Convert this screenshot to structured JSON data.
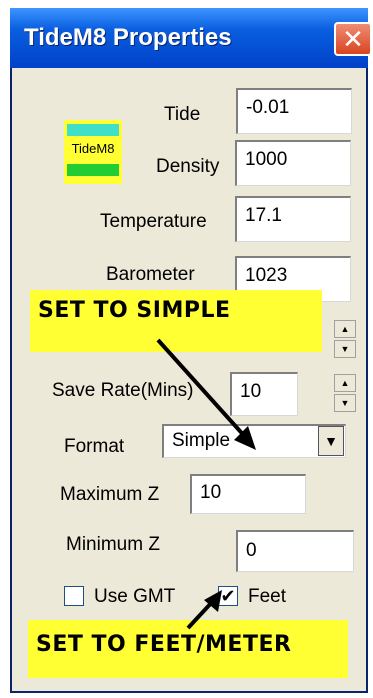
{
  "window": {
    "title": "TideM8 Properties",
    "close_glyph": "✕"
  },
  "logo": {
    "text": "TideM8"
  },
  "fields": {
    "tide": {
      "label": "Tide",
      "value": "-0.01"
    },
    "density": {
      "label": "Density",
      "value": "1000"
    },
    "temperature": {
      "label": "Temperature",
      "value": "17.1"
    },
    "barometer": {
      "label": "Barometer",
      "value": "1023"
    },
    "save_rate": {
      "label": "Save Rate(Mins)",
      "value": "10"
    },
    "format": {
      "label": "Format",
      "value": "Simple"
    },
    "maximum_z": {
      "label": "Maximum Z",
      "value": "10"
    },
    "minimum_z": {
      "label": "Minimum Z",
      "value": "0"
    }
  },
  "checkboxes": {
    "use_gmt": {
      "label": "Use GMT",
      "checked": false
    },
    "feet": {
      "label": "Feet",
      "checked": true,
      "mark": "✔"
    }
  },
  "spinner": {
    "up": "▲",
    "down": "▼"
  },
  "dropdown": {
    "arrow": "▼"
  },
  "annotations": {
    "set_to_simple": "SET TO SIMPLE",
    "set_to_feet_meter": "SET TO FEET/METER"
  },
  "colors": {
    "titlebar": "#0a5fe0",
    "dialog": "#ece9d8",
    "callout": "#ffff33",
    "close": "#d9441f",
    "logo_teal": "#40e0c8",
    "logo_green": "#22cc33"
  }
}
